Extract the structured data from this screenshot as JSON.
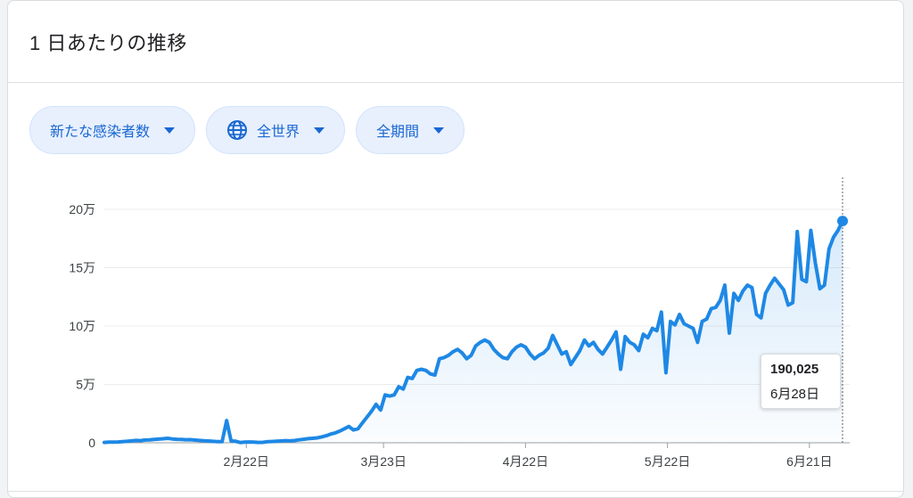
{
  "header": {
    "title": "1 日あたりの推移"
  },
  "filters": [
    {
      "label": "新たな感染者数",
      "icon": ""
    },
    {
      "label": "全世界",
      "icon": "globe-icon"
    },
    {
      "label": "全期間",
      "icon": ""
    }
  ],
  "colors": {
    "line": "#1e88e5",
    "chip_bg": "#e8f0fe",
    "chip_text": "#1967d2"
  },
  "tooltip": {
    "value": "190,025",
    "date": "6月28日"
  },
  "chart_data": {
    "type": "area",
    "title": "",
    "xlabel": "",
    "ylabel": "",
    "ylim": [
      0,
      200000
    ],
    "yticks": [
      0,
      50000,
      100000,
      150000,
      200000
    ],
    "ytick_labels": [
      "0",
      "5万",
      "10万",
      "15万",
      "20万"
    ],
    "x_tick_labels": [
      "2月22日",
      "3月23日",
      "4月22日",
      "5月22日",
      "6月21日"
    ],
    "x_tick_days": [
      52,
      81,
      111,
      141,
      171
    ],
    "x_start_day": 22,
    "x_end_day": 178,
    "grid": true,
    "series": [
      {
        "values": [
          300,
          500,
          600,
          700,
          900,
          1200,
          1600,
          2000,
          1800,
          2400,
          2500,
          2800,
          3100,
          3400,
          3800,
          3300,
          3000,
          2900,
          2600,
          2700,
          2300,
          2000,
          1700,
          1500,
          1200,
          1000,
          900,
          19000,
          1500,
          1300,
          200,
          500,
          700,
          600,
          300,
          400,
          900,
          1100,
          1300,
          1500,
          1800,
          1600,
          1900,
          2500,
          3000,
          3500,
          3800,
          4200,
          5000,
          6000,
          7500,
          8500,
          10000,
          12000,
          14000,
          11000,
          12000,
          17000,
          22000,
          27000,
          33000,
          28000,
          41000,
          40000,
          41000,
          48000,
          46000,
          56000,
          55000,
          62000,
          63000,
          62000,
          59000,
          58000,
          72000,
          73000,
          75000,
          78000,
          80000,
          77000,
          72000,
          75000,
          83000,
          86000,
          88000,
          86000,
          80000,
          76000,
          73000,
          72000,
          78000,
          82000,
          84000,
          82000,
          76000,
          72000,
          75000,
          77000,
          81000,
          92000,
          84000,
          76000,
          78000,
          67000,
          73000,
          79000,
          88000,
          83000,
          86000,
          80000,
          76000,
          82000,
          88000,
          95000,
          63000,
          91000,
          86000,
          84000,
          79000,
          93000,
          90000,
          98000,
          96000,
          112000,
          60000,
          104000,
          101000,
          110000,
          102000,
          100000,
          98000,
          86000,
          104000,
          106000,
          115000,
          116000,
          122000,
          135000,
          94000,
          128000,
          122000,
          130000,
          135000,
          133000,
          110000,
          107000,
          128000,
          135000,
          141000,
          136000,
          131000,
          118000,
          120000,
          181000,
          140000,
          138000,
          182000,
          154000,
          132000,
          135000,
          166000,
          176000,
          182000,
          190025
        ]
      }
    ]
  }
}
